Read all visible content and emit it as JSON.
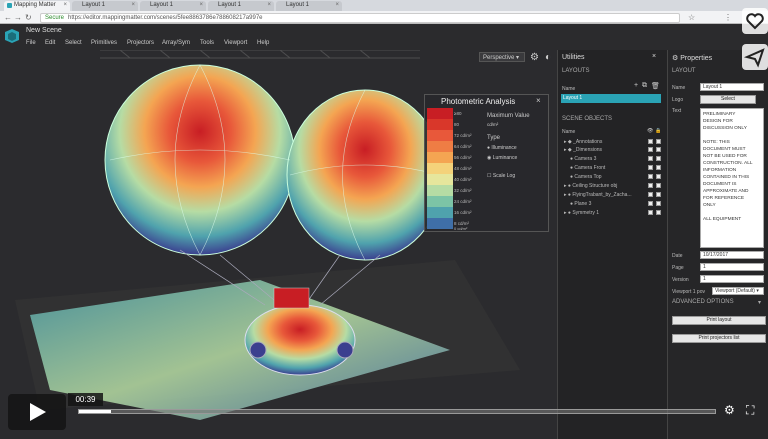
{
  "browser": {
    "tabs": [
      {
        "label": "Mapping Matter",
        "active": true
      },
      {
        "label": "Layout 1",
        "active": false
      },
      {
        "label": "Layout 1",
        "active": false
      },
      {
        "label": "Layout 1",
        "active": false
      },
      {
        "label": "Layout 1",
        "active": false
      }
    ],
    "secure_label": "Secure",
    "url": "https://editor.mappingmatter.com/scenes/5fee8863786e788608217a997e"
  },
  "app": {
    "scene_title": "New Scene",
    "menu": [
      "File",
      "Edit",
      "Select",
      "Primitives",
      "Projectors",
      "Array/Sym",
      "Tools",
      "Viewport",
      "Help"
    ],
    "viewport_mode": "Perspective"
  },
  "photometric": {
    "title": "Photometric Analysis",
    "max_label": "Maximum Value",
    "max_value": "cd/m²",
    "type_label": "Type",
    "options": [
      "Illuminance",
      "Luminance"
    ],
    "scale_log": "Scale Log",
    "legend": [
      {
        "label": "≥80",
        "color": "#c81e24"
      },
      {
        "label": "80",
        "color": "#d9372a"
      },
      {
        "label": "72 cd/m²",
        "color": "#e8583a"
      },
      {
        "label": "64 cd/m²",
        "color": "#ef7d44"
      },
      {
        "label": "56 cd/m²",
        "color": "#f4a552"
      },
      {
        "label": "48 cd/m²",
        "color": "#f4d27a"
      },
      {
        "label": "40 cd/m²",
        "color": "#e6e69c"
      },
      {
        "label": "32 cd/m²",
        "color": "#b6dca4"
      },
      {
        "label": "24 cd/m²",
        "color": "#7cc4a6"
      },
      {
        "label": "16 cd/m²",
        "color": "#4fa2ad"
      },
      {
        "label": "8 cd/m²",
        "color": "#3f6fa8"
      },
      {
        "label": "0 cd/m²",
        "color": "#3b3f8f"
      }
    ]
  },
  "utilities": {
    "title": "Utilities",
    "layouts_label": "LAYOUTS",
    "name_label": "Name",
    "layout_item": "Layout 1",
    "scene_objects_label": "SCENE OBJECTS",
    "objects": [
      "_Annotations",
      "_Dimensions",
      "Camera 3",
      "Camera Front",
      "Camera Top",
      "Ceiling Structure obj",
      "FlyingTrabant_by_Zacha...",
      "Plane 3",
      "Symmetry 1"
    ]
  },
  "properties": {
    "title": "Properties",
    "layout_label": "LAYOUT",
    "name_label": "Name",
    "name_value": "Layout 1",
    "logo_label": "Logo",
    "select_button": "Select",
    "text_label": "Text",
    "text_lines": [
      "PRELIMINARY",
      "DESIGN FOR",
      "DISCUSSION ONLY",
      "",
      "NOTE: THIS",
      "DOCUMENT MUST",
      "NOT BE USED FOR",
      "CONSTRUCTION. ALL",
      "INFORMATION",
      "CONTAINED IN THIS",
      "DOCUMENT IS",
      "APPROXIMATE AND",
      "FOR REFERENCE",
      "ONLY",
      "",
      "ALL EQUIPMENT"
    ],
    "date_label": "Date",
    "date_value": "10/17/2017",
    "page_label": "Page",
    "page_value": "1",
    "version_label": "Version",
    "version_value": "1",
    "viewport_label": "Viewport 1 pov",
    "viewport_value": "Viewport (Default)",
    "advanced_label": "ADVANCED OPTIONS",
    "print_layout": "Print layout",
    "print_projectors": "Print projectors list"
  },
  "video": {
    "time": "00:39",
    "progress": 0.05
  }
}
